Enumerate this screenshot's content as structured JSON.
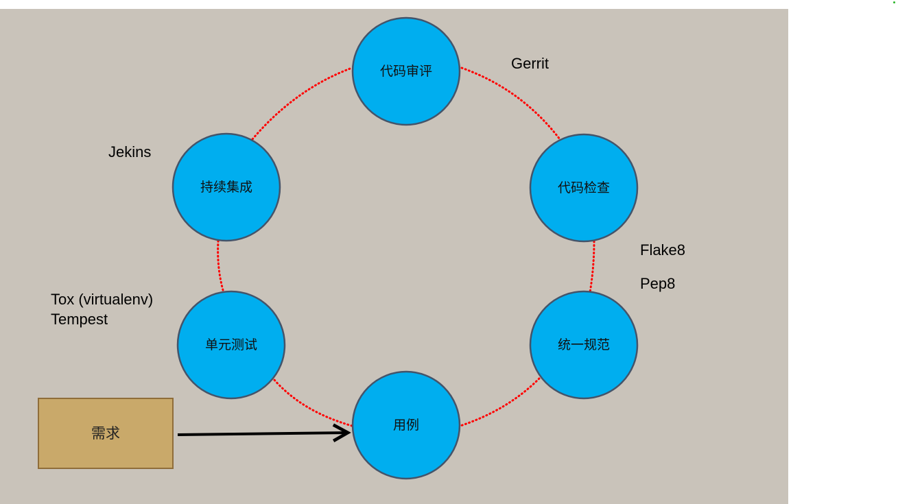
{
  "diagram": {
    "nodes": {
      "code_review": "代码审评",
      "code_check": "代码检查",
      "unified_spec": "统一规范",
      "use_case": "用例",
      "unit_test": "单元测试",
      "continuous_integration": "持续集成"
    },
    "tools": {
      "gerrit": "Gerrit",
      "jekins": "Jekins",
      "flake8": "Flake8",
      "pep8": "Pep8",
      "tox": "Tox (virtualenv)",
      "tempest": "Tempest"
    },
    "requirement": "需求"
  },
  "colors": {
    "background": "#c9c3ba",
    "node_fill": "#00aeef",
    "node_stroke": "#44546a",
    "cycle_dots": "#ff0000",
    "requirement_fill": "#c9a96a",
    "requirement_stroke": "#8f6d3a",
    "arrow": "#000000"
  }
}
